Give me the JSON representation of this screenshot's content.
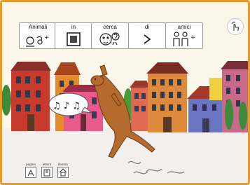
{
  "sentence": [
    {
      "label": "Animali",
      "icon": "animals-icon"
    },
    {
      "label": "in",
      "icon": "square-icon"
    },
    {
      "label": "cerca",
      "icon": "searching-face-icon"
    },
    {
      "label": "di",
      "icon": "arrow-right-icon"
    },
    {
      "label": "amici",
      "icon": "friends-icon"
    }
  ],
  "speech_icon": "notes-speech-bubble-icon",
  "top_right": {
    "icon": "hand-touch-icon"
  },
  "nav": [
    {
      "label": "pagina",
      "icon": "page-icon"
    },
    {
      "label": "lettura",
      "icon": "reading-icon"
    },
    {
      "label": "libreria",
      "icon": "library-icon"
    }
  ],
  "colors": {
    "frame": "#e79a2a",
    "background": "#fbf6ea"
  }
}
